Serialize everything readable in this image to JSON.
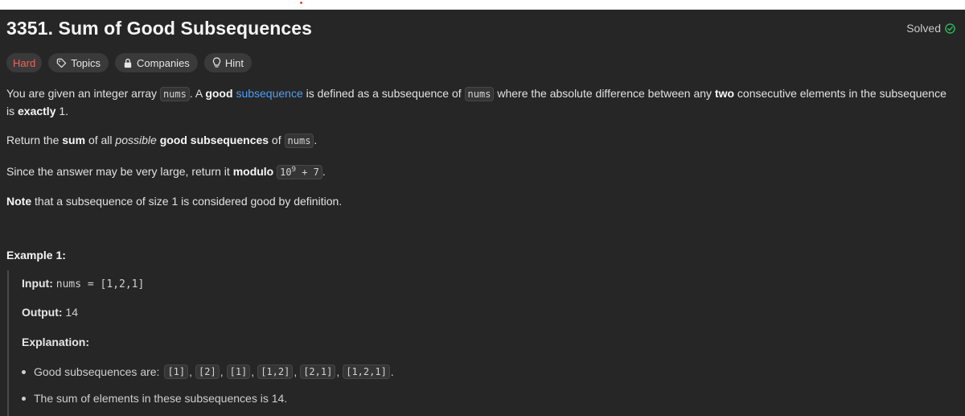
{
  "problem": {
    "title": "3351. Sum of Good Subsequences",
    "status": "Solved",
    "difficulty": "Hard",
    "tags": [
      "Topics",
      "Companies",
      "Hint"
    ]
  },
  "description": {
    "p1": {
      "t1": "You are given an integer array ",
      "c1": "nums",
      "t2": ". A ",
      "b1": "good",
      "t3": " ",
      "link": "subsequence",
      "t4": " is defined as a subsequence of ",
      "c2": "nums",
      "t5": " where the absolute difference between any ",
      "b2": "two",
      "t6": " consecutive elements in the subsequence is ",
      "b3": "exactly",
      "t7": " 1."
    },
    "p2": {
      "t1": "Return the ",
      "b1": "sum",
      "t2": " of all ",
      "i1": "possible",
      "t3": " ",
      "b2": "good subsequences",
      "t4": " of ",
      "c1": "nums",
      "t5": "."
    },
    "p3": {
      "t1": "Since the answer may be very large, return it ",
      "b1": "modulo",
      "t2": " ",
      "c_base": "10",
      "c_exp": "9",
      "c_rest": " + 7",
      "t3": "."
    },
    "p4": {
      "b1": "Note",
      "t1": " that a subsequence of size 1 is considered good by definition."
    }
  },
  "example1": {
    "title": "Example 1:",
    "input_label": "Input:",
    "input_value": "nums = [1,2,1]",
    "output_label": "Output:",
    "output_value": "14",
    "explanation_label": "Explanation:",
    "bullet1_text": "Good subsequences are:",
    "subsequences": [
      "[1]",
      "[2]",
      "[1]",
      "[1,2]",
      "[2,1]",
      "[1,2,1]"
    ],
    "bullet2_text": "The sum of elements in these subsequences is 14."
  },
  "colors": {
    "background": "#262626",
    "hard": "#f0625a",
    "link": "#4f9cf5",
    "solved_check": "#2cbb5d"
  }
}
